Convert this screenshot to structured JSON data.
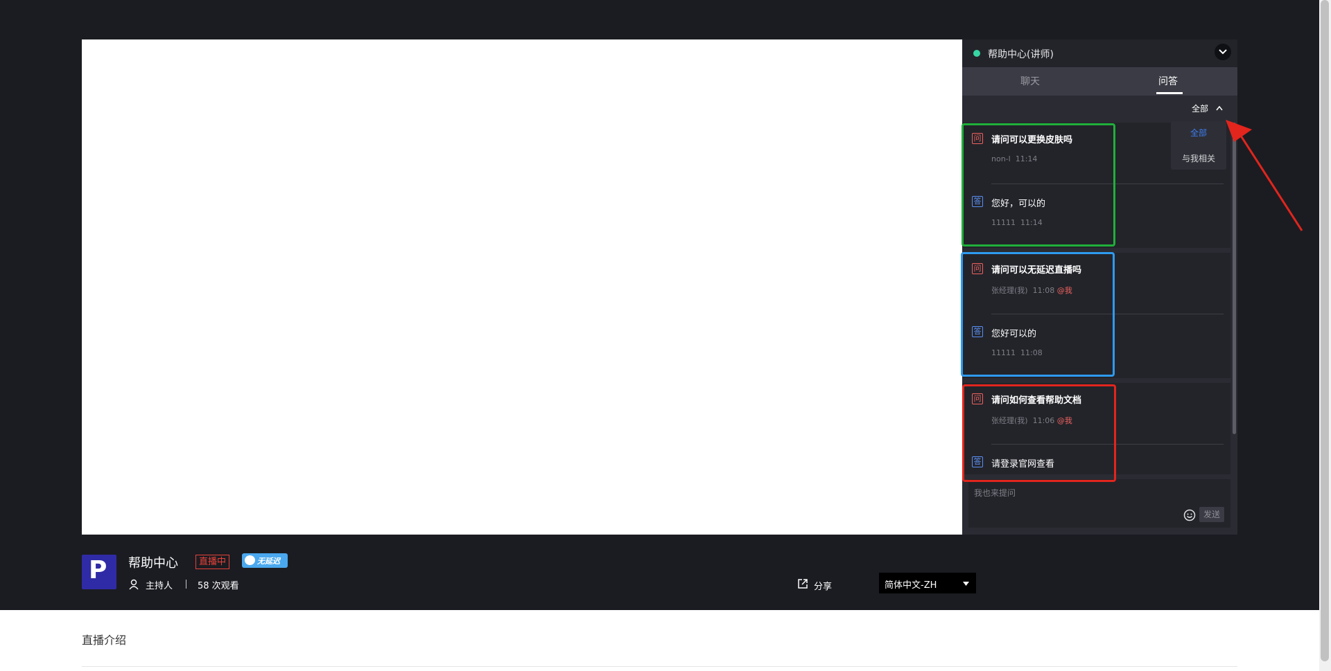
{
  "panel": {
    "title": "帮助中心(讲师)",
    "tabs": [
      {
        "label": "聊天"
      },
      {
        "label": "问答"
      }
    ],
    "filter_label": "全部",
    "dropdown": [
      {
        "label": "全部"
      },
      {
        "label": "与我相关"
      }
    ]
  },
  "qa": [
    {
      "question": "请问可以更换皮肤吗",
      "q_user": "non-l",
      "q_time": "11:14",
      "q_at": "",
      "answer": "您好，可以的",
      "a_user": "11111",
      "a_time": "11:14"
    },
    {
      "question": "请问可以无延迟直播吗",
      "q_user": "张经理(我)",
      "q_time": "11:08",
      "q_at": "@我",
      "answer": "您好可以的",
      "a_user": "11111",
      "a_time": "11:08"
    },
    {
      "question": "请问如何查看帮助文档",
      "q_user": "张经理(我)",
      "q_time": "11:06",
      "q_at": "@我",
      "answer": "请登录官网查看",
      "a_user": "",
      "a_time": ""
    }
  ],
  "badges": {
    "question": "问",
    "answer": "答"
  },
  "composer": {
    "placeholder": "我也来提问",
    "send_label": "发送"
  },
  "room": {
    "logo_letter": "P",
    "title": "帮助中心",
    "live_badge": "直播中",
    "nodelay_badge": "无延迟",
    "host_label": "主持人",
    "views": "58 次观看",
    "share_label": "分享",
    "language": "简体中文-ZH"
  },
  "intro": {
    "title": "直播介绍"
  },
  "colors": {
    "background": "#1b1c21",
    "accent_blue": "#3d7ef2",
    "live_green": "#37d6a2",
    "question_red": "#f0625f",
    "highlight_green": "#1fb03a",
    "highlight_blue": "#2e9bf0",
    "highlight_red": "#e2251d"
  }
}
